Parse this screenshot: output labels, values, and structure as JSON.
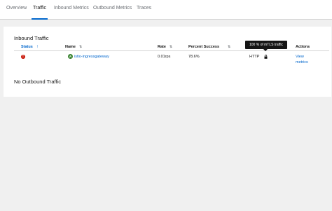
{
  "tabs": [
    {
      "label": "Overview",
      "active": false
    },
    {
      "label": "Traffic",
      "active": true
    },
    {
      "label": "Inbound Metrics",
      "active": false
    },
    {
      "label": "Outbound Metrics",
      "active": false
    },
    {
      "label": "Traces",
      "active": false
    }
  ],
  "inbound": {
    "title": "Inbound Traffic",
    "columns": {
      "status": "Status",
      "name": "Name",
      "rate": "Rate",
      "percent_success": "Percent Success",
      "protocol": "",
      "actions": "Actions"
    },
    "rows": [
      {
        "status_icon": "error-circle-icon",
        "badge": "A",
        "name": "istio-ingressgateway",
        "rate": "0.01rps",
        "percent_success": "78.6%",
        "protocol": "HTTP",
        "lock_icon": "lock-icon",
        "action_line1": "View",
        "action_line2": "metrics"
      }
    ]
  },
  "tooltip": "100 % of mTLS traffic",
  "outbound": {
    "empty_text": "No Outbound Traffic"
  },
  "colors": {
    "accent": "#0066cc",
    "error": "#c9190b",
    "badge": "#3e8635",
    "page_bg": "#f0f0f0"
  }
}
